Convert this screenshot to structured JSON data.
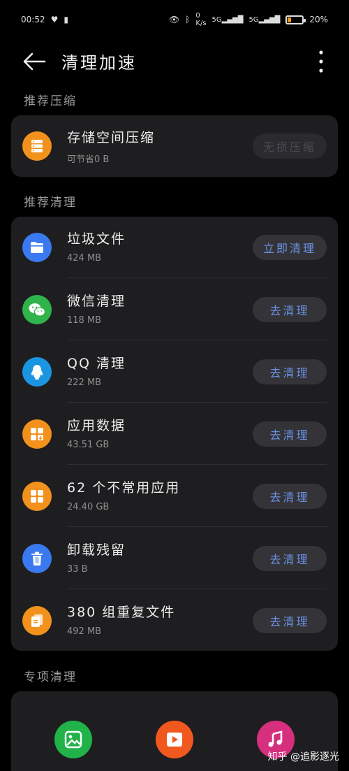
{
  "status_bar": {
    "time": "00:52",
    "speed_top": "0",
    "speed_unit": "K/s",
    "signal1": "5G",
    "signal2": "5G",
    "battery": "20%"
  },
  "app_bar": {
    "title": "清理加速",
    "back_icon": "arrow-left-icon",
    "more_icon": "more-vert-icon"
  },
  "sections": {
    "compress_title": "推荐压缩",
    "clean_title": "推荐清理",
    "special_title": "专项清理"
  },
  "compress": {
    "name": "存储空间压缩",
    "size": "可节省0 B",
    "button": "无损压缩"
  },
  "clean_items": [
    {
      "name": "垃圾文件",
      "size": "424 MB",
      "button": "立即清理",
      "icon": "folder-icon",
      "color": "#3b79f0"
    },
    {
      "name": "微信清理",
      "size": "118 MB",
      "button": "去清理",
      "icon": "wechat-icon",
      "color": "#2fb44b"
    },
    {
      "name": "QQ 清理",
      "size": "222 MB",
      "button": "去清理",
      "icon": "qq-penguin-icon",
      "color": "#1a95e0"
    },
    {
      "name": "应用数据",
      "size": "43.51 GB",
      "button": "去清理",
      "icon": "app-data-icon",
      "color": "#f2911b"
    },
    {
      "name": "62 个不常用应用",
      "size": "24.40 GB",
      "button": "去清理",
      "icon": "apps-grid-icon",
      "color": "#f2911b"
    },
    {
      "name": "卸载残留",
      "size": "33 B",
      "button": "去清理",
      "icon": "trash-icon",
      "color": "#3b79f0"
    },
    {
      "name": "380 组重复文件",
      "size": "492 MB",
      "button": "去清理",
      "icon": "duplicate-file-icon",
      "color": "#f2911b"
    }
  ],
  "special": {
    "items": [
      {
        "icon": "image-icon",
        "color": "#22b24a"
      },
      {
        "icon": "video-icon",
        "color": "#f0581e"
      },
      {
        "icon": "music-icon",
        "color": "#d62f7e"
      }
    ]
  },
  "watermark": "知乎 @追影逐光"
}
